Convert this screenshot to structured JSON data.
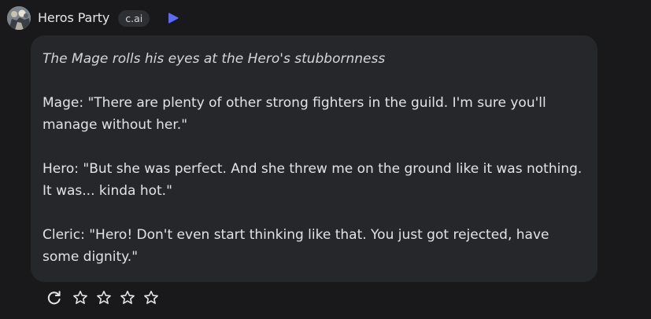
{
  "header": {
    "character_name": "Heros Party",
    "badge": "c.ai",
    "play_icon": "play-icon",
    "accent_color": "#5b6cf0"
  },
  "message": {
    "action": "The Mage rolls his eyes at the Hero's stubbornness",
    "lines": [
      "Mage: \"There are plenty of other strong fighters in the guild. I'm sure you'll manage without her.\"",
      "Hero: \"But she was perfect. And she threw me on the ground like it was nothing. It was... kinda hot.\"",
      "Cleric: \"Hero! Don't even start thinking like that. You just got rejected, have some dignity.\""
    ]
  },
  "actions": {
    "refresh_icon": "refresh-icon",
    "rating_max": 4,
    "rating_value": 0
  }
}
